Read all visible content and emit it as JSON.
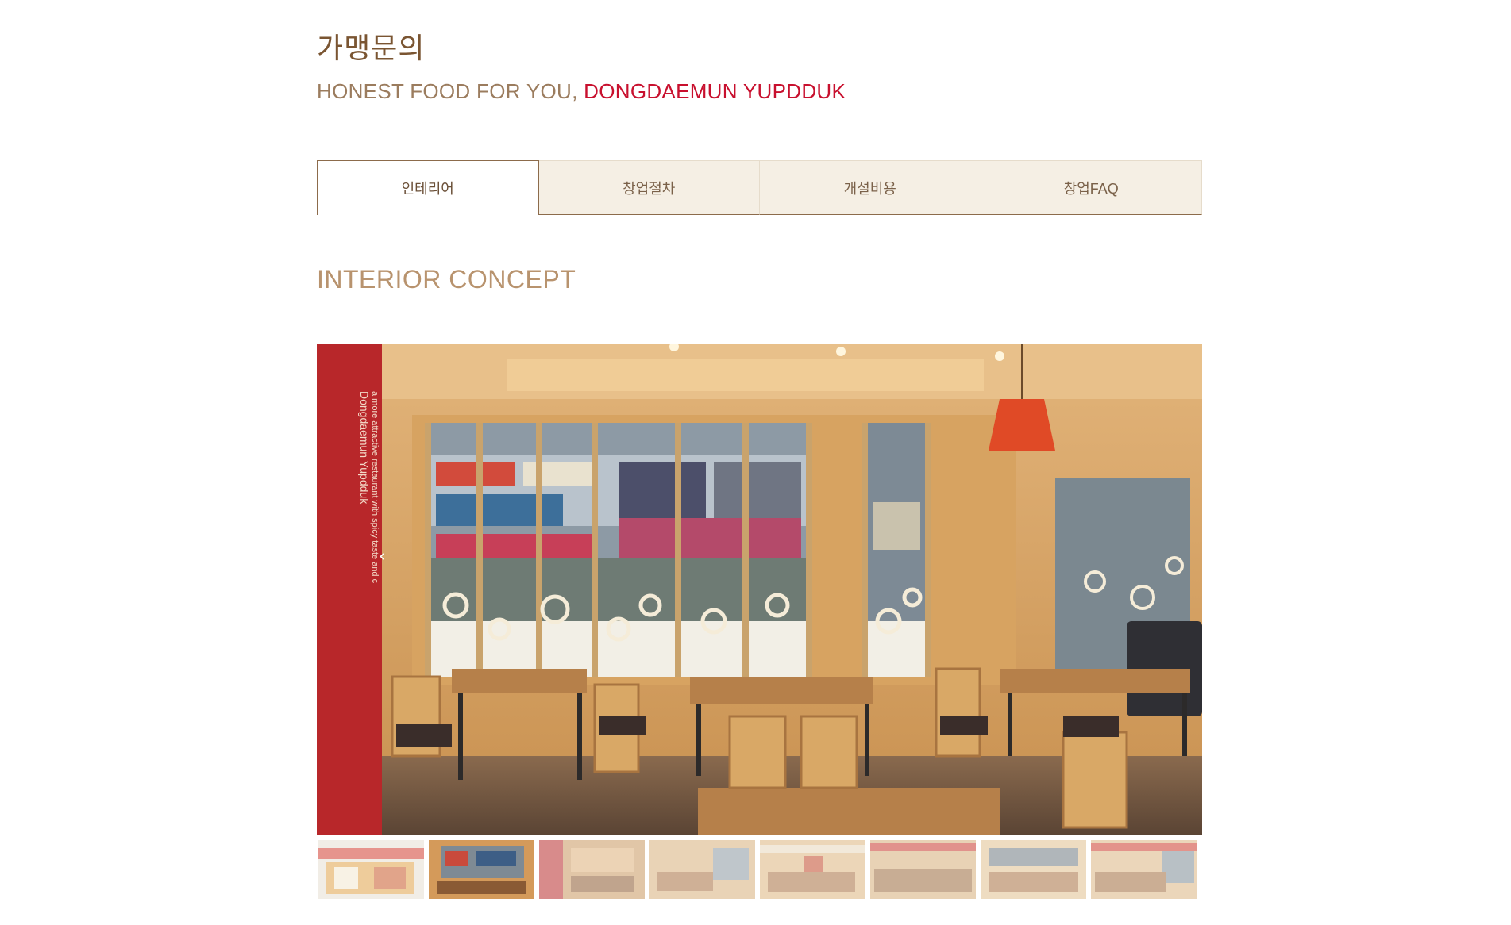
{
  "header": {
    "title": "가맹문의",
    "tagline_prefix": "HONEST FOOD FOR YOU, ",
    "tagline_brand": "DONGDAEMUN YUPDDUK"
  },
  "tabs": [
    {
      "label": "인테리어",
      "active": true
    },
    {
      "label": "창업절차",
      "active": false
    },
    {
      "label": "개설비용",
      "active": false
    },
    {
      "label": "창업FAQ",
      "active": false
    }
  ],
  "section": {
    "title": "INTERIOR CONCEPT"
  },
  "gallery": {
    "prev_icon": "chevron-left-icon",
    "banner_text_line1": "Dongdaemun Yupdduk",
    "banner_text_line2": "a more attractive restaurant with spicy taste and c",
    "selected_index": 1,
    "thumbnail_count": 8
  },
  "colors": {
    "title_brown": "#7a5532",
    "brand_red": "#c8102e",
    "tab_bg": "#f5efe4",
    "tab_border": "#8c6b4b",
    "section_title": "#b8936e"
  }
}
